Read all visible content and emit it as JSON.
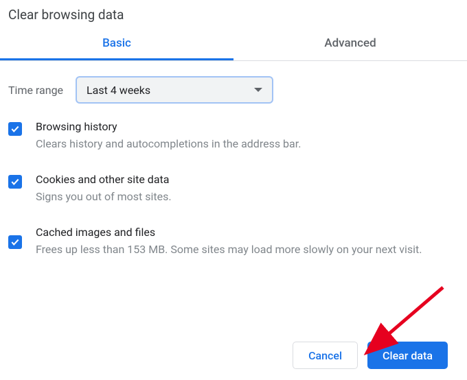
{
  "title": "Clear browsing data",
  "tabs": {
    "basic": "Basic",
    "advanced": "Advanced"
  },
  "time_range": {
    "label": "Time range",
    "value": "Last 4 weeks"
  },
  "options": [
    {
      "title": "Browsing history",
      "desc": "Clears history and autocompletions in the address bar.",
      "checked": true
    },
    {
      "title": "Cookies and other site data",
      "desc": "Signs you out of most sites.",
      "checked": true
    },
    {
      "title": "Cached images and files",
      "desc": "Frees up less than 153 MB. Some sites may load more slowly on your next visit.",
      "checked": true
    }
  ],
  "buttons": {
    "cancel": "Cancel",
    "clear": "Clear data"
  }
}
